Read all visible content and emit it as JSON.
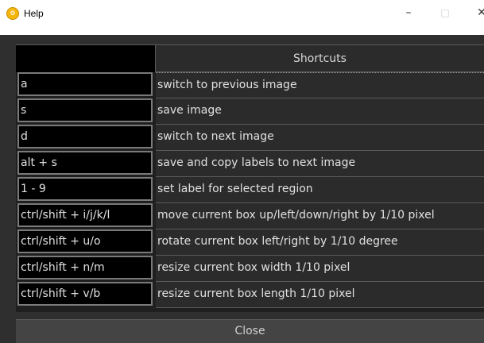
{
  "window": {
    "title": "Help",
    "minimize_glyph": "–",
    "maximize_glyph": "□",
    "close_glyph": "✕",
    "icon": "app-logo-icon"
  },
  "table": {
    "header_label": "Shortcuts",
    "rows": [
      {
        "key": "a",
        "description": "switch to previous image"
      },
      {
        "key": "s",
        "description": "save image"
      },
      {
        "key": "d",
        "description": "switch to next image"
      },
      {
        "key": "alt + s",
        "description": "save and copy labels to next image"
      },
      {
        "key": "1 - 9",
        "description": "set label for selected region"
      },
      {
        "key": "ctrl/shift + i/j/k/l",
        "description": "move current box up/left/down/right by 1/10 pixel"
      },
      {
        "key": "ctrl/shift + u/o",
        "description": "rotate current box left/right by 1/10 degree"
      },
      {
        "key": "ctrl/shift + n/m",
        "description": "resize current box width 1/10 pixel"
      },
      {
        "key": "ctrl/shift + v/b",
        "description": "resize current box length 1/10 pixel"
      }
    ]
  },
  "footer": {
    "close_label": "Close"
  },
  "colors": {
    "background": "#2f2f2f",
    "cell_background": "#2b2b2b",
    "key_background": "#000000",
    "text": "#e0e0e0",
    "icon_accent": "#f5b60a"
  }
}
